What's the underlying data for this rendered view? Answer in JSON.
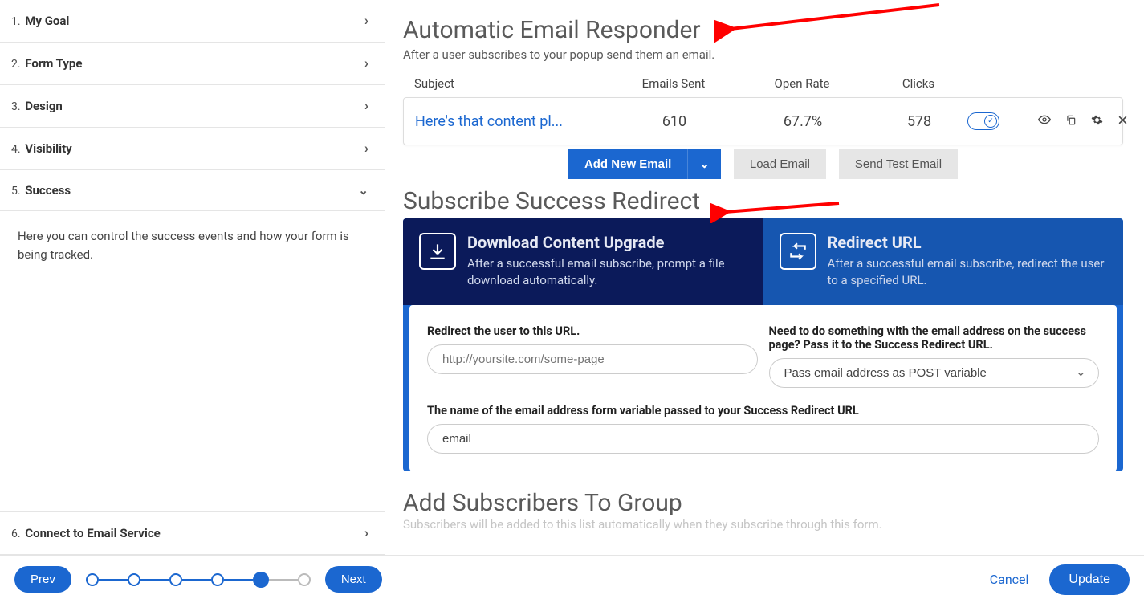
{
  "sidebar": {
    "items": [
      {
        "num": "1.",
        "label": "My Goal",
        "chev": "›"
      },
      {
        "num": "2.",
        "label": "Form Type",
        "chev": "›"
      },
      {
        "num": "3.",
        "label": "Design",
        "chev": "›"
      },
      {
        "num": "4.",
        "label": "Visibility",
        "chev": "›"
      },
      {
        "num": "5.",
        "label": "Success",
        "chev": "⌄"
      }
    ],
    "description": "Here you can control the success events and how your form is being tracked.",
    "bottom_item": {
      "num": "6.",
      "label": "Connect to Email Service",
      "chev": "›"
    }
  },
  "responder": {
    "title": "Automatic Email Responder",
    "subtitle": "After a user subscribes to your popup send them an email.",
    "headers": {
      "subject": "Subject",
      "sent": "Emails Sent",
      "open": "Open Rate",
      "clicks": "Clicks"
    },
    "row": {
      "subject": "Here's that content pl...",
      "sent": "610",
      "open": "67.7%",
      "clicks": "578",
      "toggle_check": "✓"
    },
    "buttons": {
      "add": "Add New Email",
      "caret": "⌄",
      "load": "Load Email",
      "send_test": "Send Test Email"
    }
  },
  "redirect": {
    "title": "Subscribe Success Redirect",
    "tabs": {
      "download": {
        "title": "Download Content Upgrade",
        "desc": "After a successful email subscribe, prompt a file download automatically."
      },
      "url": {
        "title": "Redirect URL",
        "desc": "After a successful email subscribe, redirect the user to a specified URL."
      }
    },
    "form": {
      "url_label": "Redirect the user to this URL.",
      "url_placeholder": "http://yoursite.com/some-page",
      "pass_label": "Need to do something with the email address on the success page? Pass it to the Success Redirect URL.",
      "pass_option": "Pass email address as POST variable",
      "var_label": "The name of the email address form variable passed to your Success Redirect URL",
      "var_value": "email"
    }
  },
  "group": {
    "title": "Add Subscribers To Group",
    "subtitle": "Subscribers will be added to this list automatically when they subscribe through this form."
  },
  "footer": {
    "prev": "Prev",
    "next": "Next",
    "cancel": "Cancel",
    "update": "Update"
  }
}
